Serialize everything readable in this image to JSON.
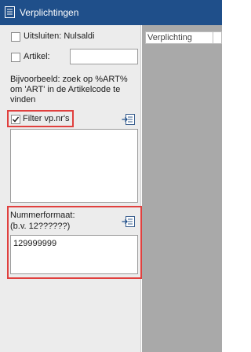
{
  "window": {
    "title": "Verplichtingen"
  },
  "filters": {
    "uitsluiten_label": "Uitsluiten: Nulsaldi",
    "uitsluiten_checked": false,
    "artikel_label": "Artikel:",
    "artikel_checked": false,
    "artikel_value": "",
    "example_text": "Bijvoorbeeld: zoek op %ART% om 'ART' in de Artikelcode te vinden",
    "filter_vpnr_label": "Filter vp.nr's",
    "filter_vpnr_checked": true,
    "nummerformaat_label": "Nummerformaat:",
    "nummerformaat_hint": "(b.v. 12??????)",
    "nummerformaat_value": "129999999",
    "import_icon": "import-list-icon"
  },
  "grid": {
    "columns": [
      "Verplichting",
      ""
    ]
  },
  "colors": {
    "titlebar": "#1f4f8a",
    "panel": "#ececec",
    "grid_area": "#a9a9a9",
    "highlight": "#e0403e"
  }
}
